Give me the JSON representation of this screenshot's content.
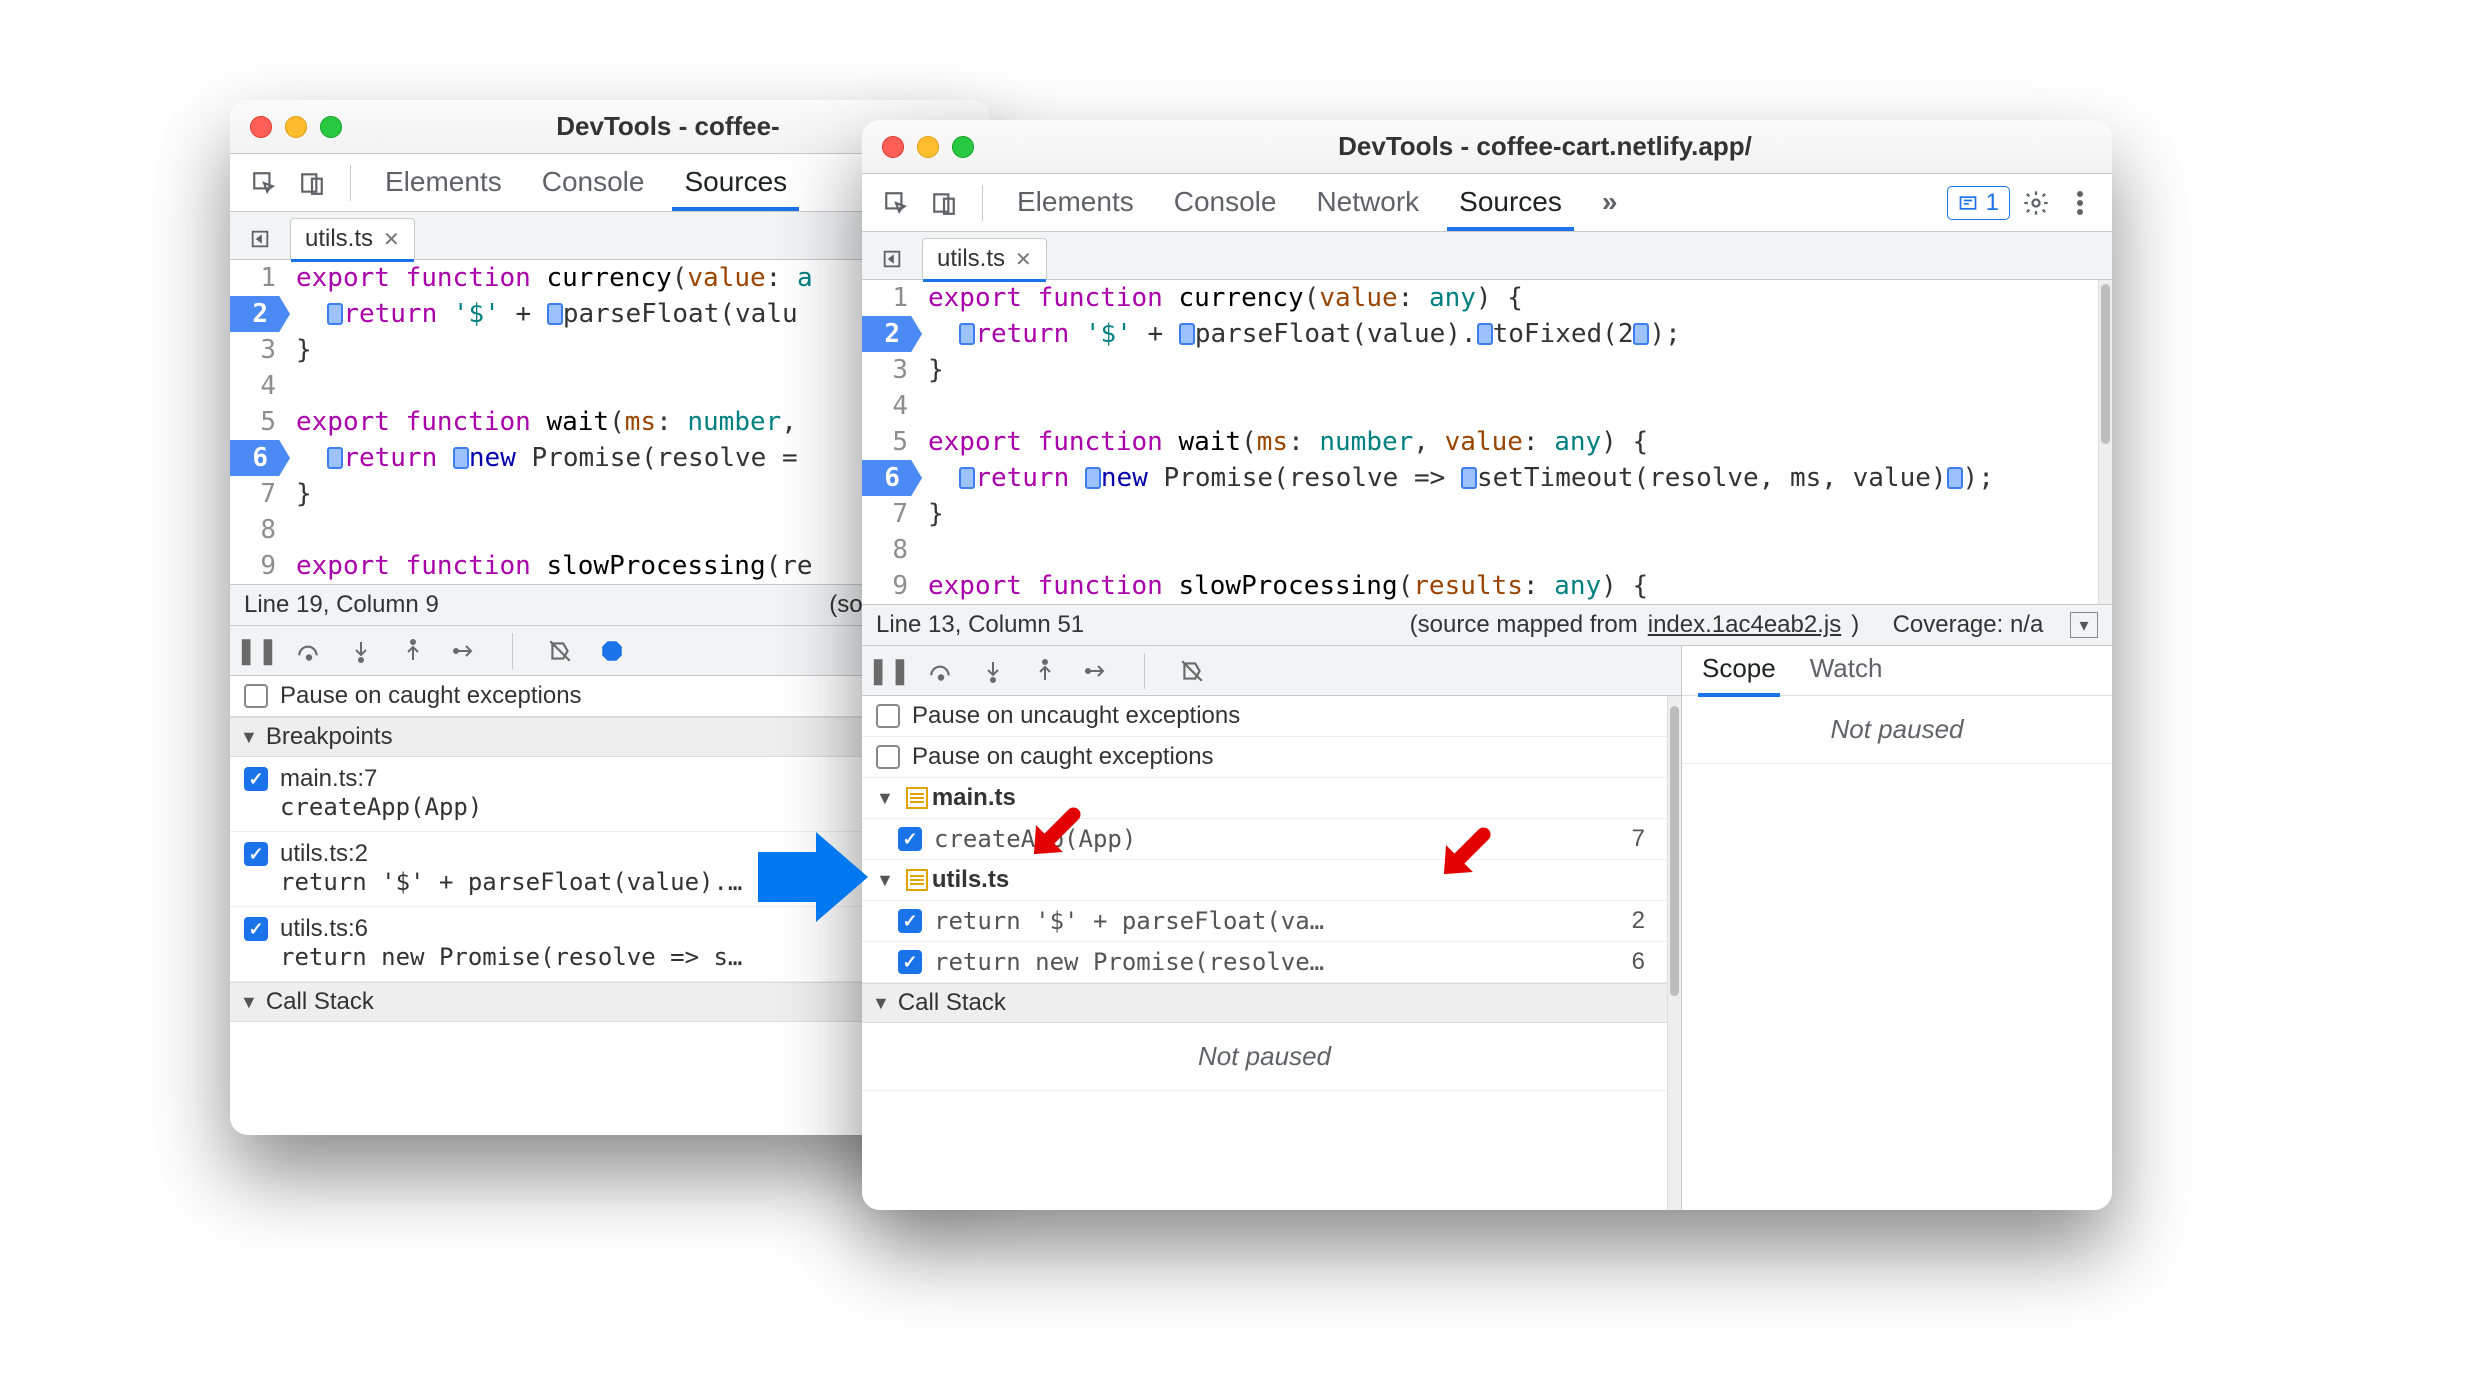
{
  "back": {
    "title": "DevTools - coffee-",
    "panels": [
      "Elements",
      "Console",
      "Sources"
    ],
    "active_panel": 2,
    "file_tab": "utils.ts",
    "code": {
      "lines": [
        {
          "n": 1,
          "bp": false,
          "html": "<span class='kw'>export</span> <span class='kw'>function</span> <span class='fn'>currency</span>(<span class='arg'>value</span>: <span class='ty'>a</span>"
        },
        {
          "n": 2,
          "bp": true,
          "html": "  <span class='chip'></span><span class='kw'>return</span> <span class='ty'>'$'</span> + <span class='chip'></span>parseFloat(valu"
        },
        {
          "n": 3,
          "bp": false,
          "html": "}"
        },
        {
          "n": 4,
          "bp": false,
          "html": ""
        },
        {
          "n": 5,
          "bp": false,
          "html": "<span class='kw'>export</span> <span class='kw'>function</span> <span class='fn'>wait</span>(<span class='arg'>ms</span>: <span class='ty'>number</span>, "
        },
        {
          "n": 6,
          "bp": true,
          "html": "  <span class='chip'></span><span class='kw'>return</span> <span class='chip'></span><span class='nkw'>new</span> Promise(resolve ="
        },
        {
          "n": 7,
          "bp": false,
          "html": "}"
        },
        {
          "n": 8,
          "bp": false,
          "html": ""
        },
        {
          "n": 9,
          "bp": false,
          "html": "<span class='kw'>export</span> <span class='kw'>function</span> <span class='fn'>slowProcessing</span>(re"
        }
      ]
    },
    "status_left": "Line 19, Column 9",
    "status_right": "(source mapp",
    "pause_caught": "Pause on caught exceptions",
    "breakpoints_hdr": "Breakpoints",
    "breakpoints": [
      {
        "file": "main.ts:7",
        "code": "createApp(App)"
      },
      {
        "file": "utils.ts:2",
        "code": "return '$' + parseFloat(value).…"
      },
      {
        "file": "utils.ts:6",
        "code": "return new Promise(resolve => s…"
      }
    ],
    "callstack_hdr": "Call Stack"
  },
  "front": {
    "title": "DevTools - coffee-cart.netlify.app/",
    "panels": [
      "Elements",
      "Console",
      "Network",
      "Sources"
    ],
    "active_panel": 3,
    "more": "»",
    "badge_count": "1",
    "file_tab": "utils.ts",
    "code": {
      "lines": [
        {
          "n": 1,
          "bp": false,
          "html": "<span class='kw'>export</span> <span class='kw'>function</span> <span class='fn'>currency</span>(<span class='arg'>value</span>: <span class='ty'>any</span>) {"
        },
        {
          "n": 2,
          "bp": true,
          "html": "  <span class='chip'></span><span class='kw'>return</span> <span class='ty'>'$'</span> + <span class='chip'></span>parseFloat(value).<span class='chip'></span>toFixed(2<span class='chip'></span>);"
        },
        {
          "n": 3,
          "bp": false,
          "html": "}"
        },
        {
          "n": 4,
          "bp": false,
          "html": ""
        },
        {
          "n": 5,
          "bp": false,
          "html": "<span class='kw'>export</span> <span class='kw'>function</span> <span class='fn'>wait</span>(<span class='arg'>ms</span>: <span class='ty'>number</span>, <span class='arg'>value</span>: <span class='ty'>any</span>) {"
        },
        {
          "n": 6,
          "bp": true,
          "html": "  <span class='chip'></span><span class='kw'>return</span> <span class='chip'></span><span class='nkw'>new</span> Promise(resolve =&gt; <span class='chip'></span>setTimeout(resolve, ms, value)<span class='chip'></span>);"
        },
        {
          "n": 7,
          "bp": false,
          "html": "}"
        },
        {
          "n": 8,
          "bp": false,
          "html": ""
        },
        {
          "n": 9,
          "bp": false,
          "html": "<span class='kw'>export</span> <span class='kw'>function</span> <span class='fn'>slowProcessing</span>(<span class='arg'>results</span>: <span class='ty'>any</span>) {"
        }
      ]
    },
    "status_left": "Line 13, Column 51",
    "status_mid": "(source mapped from ",
    "status_link": "index.1ac4eab2.js",
    "status_end": ")",
    "coverage": "Coverage: n/a",
    "pause_uncaught": "Pause on uncaught exceptions",
    "pause_caught": "Pause on caught exceptions",
    "bp_groups": [
      {
        "file": "main.ts",
        "items": [
          {
            "code": "createApp(App)",
            "line": "7"
          }
        ]
      },
      {
        "file": "utils.ts",
        "items": [
          {
            "code": "return '$' + parseFloat(va…",
            "line": "2"
          },
          {
            "code": "return new Promise(resolve…",
            "line": "6"
          }
        ]
      }
    ],
    "callstack_hdr": "Call Stack",
    "not_paused": "Not paused",
    "scope_tab": "Scope",
    "watch_tab": "Watch",
    "right_not_paused": "Not paused"
  }
}
